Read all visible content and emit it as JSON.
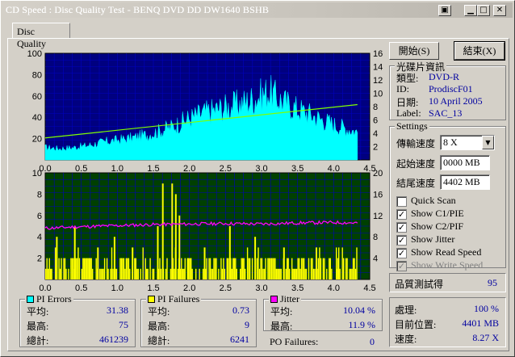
{
  "window": {
    "title": "CD Speed : Disc Quality Test - BENQ    DVD DD DW1640    BSHB",
    "min_glyph": "▁",
    "max_glyph": "□",
    "close_glyph": "✕",
    "help_glyph": "▣"
  },
  "tab": {
    "label": "Disc Quality"
  },
  "buttons": {
    "start": "開始(S)",
    "exit": "結束(X)"
  },
  "disc_info": {
    "title": "光碟片資訊",
    "type_label": "類型:",
    "type_value": "DVD-R",
    "id_label": "ID:",
    "id_value": "ProdiscF01",
    "date_label": "日期:",
    "date_value": "10 April 2005",
    "label_label": "Label:",
    "label_value": "SAC_13"
  },
  "settings": {
    "title": "Settings",
    "speed_label": "傳輸速度",
    "speed_value": "8 X",
    "start_label": "起始速度",
    "start_value": "0000 MB",
    "end_label": "結尾速度",
    "end_value": "4402 MB",
    "options": [
      {
        "label": "Quick Scan",
        "checked": ""
      },
      {
        "label": "Show C1/PIE",
        "checked": "✓"
      },
      {
        "label": "Show C2/PIF",
        "checked": "✓"
      },
      {
        "label": "Show Jitter",
        "checked": "✓"
      },
      {
        "label": "Show Read Speed",
        "checked": "✓"
      },
      {
        "label": "Show Write Speed",
        "checked": "✓"
      }
    ]
  },
  "quality": {
    "label": "品質測試得",
    "value": "95"
  },
  "progress": {
    "process_label": "處理:",
    "process_value": "100 %",
    "position_label": "目前位置:",
    "position_value": "4401 MB",
    "speed_label": "速度:",
    "speed_value": "8.27 X"
  },
  "pi_errors": {
    "title": "PI Errors",
    "avg_label": "平均:",
    "avg": "31.38",
    "max_label": "最高:",
    "max": "75",
    "total_label": "總計:",
    "total": "461239",
    "color": "#00ffff"
  },
  "pi_failures": {
    "title": "PI Failures",
    "avg_label": "平均:",
    "avg": "0.73",
    "max_label": "最高:",
    "max": "9",
    "total_label": "總計:",
    "total": "6241",
    "color": "#ffff00"
  },
  "jitter": {
    "title": "Jitter",
    "avg_label": "平均:",
    "avg": "10.04 %",
    "max_label": "最高:",
    "max": "11.9 %",
    "color": "#ff00ff"
  },
  "po_failures": {
    "label": "PO Failures:",
    "value": "0"
  },
  "chart_data": [
    {
      "type": "area",
      "title": "",
      "x_ticks": [
        "0.0",
        "0.5",
        "1.0",
        "1.5",
        "2.0",
        "2.5",
        "3.0",
        "3.5",
        "4.0",
        "4.5"
      ],
      "y_left_ticks": [
        "100",
        "80",
        "60",
        "40",
        "20"
      ],
      "y_right_ticks": [
        "16",
        "14",
        "12",
        "10",
        "8",
        "6",
        "4",
        "2"
      ],
      "xlim": [
        0,
        4.5
      ],
      "ylim_left": [
        0,
        100
      ],
      "ylim_right": [
        0,
        16
      ],
      "series": [
        {
          "name": "PI Errors",
          "color": "#00ffff",
          "x": [
            0.0,
            0.2,
            0.4,
            0.6,
            0.8,
            1.0,
            1.2,
            1.4,
            1.6,
            1.8,
            2.0,
            2.2,
            2.4,
            2.6,
            2.8,
            3.0,
            3.1,
            3.2,
            3.4,
            3.6,
            3.8,
            4.0,
            4.2,
            4.33
          ],
          "values": [
            12,
            11,
            12,
            14,
            17,
            19,
            21,
            24,
            28,
            33,
            40,
            45,
            49,
            52,
            56,
            62,
            66,
            60,
            52,
            46,
            40,
            34,
            30,
            27
          ]
        },
        {
          "name": "Read Speed",
          "color": "#80ff00",
          "x": [
            0.0,
            4.33
          ],
          "values": [
            3.3,
            8.3
          ]
        }
      ]
    },
    {
      "type": "bar",
      "title": "",
      "x_ticks": [
        "0.0",
        "0.5",
        "1.0",
        "1.5",
        "2.0",
        "2.5",
        "3.0",
        "3.5",
        "4.0",
        "4.5"
      ],
      "y_left_ticks": [
        "10",
        "8",
        "6",
        "4",
        "2"
      ],
      "y_right_ticks": [
        "20",
        "16",
        "12",
        "8",
        "4"
      ],
      "xlim": [
        0,
        4.5
      ],
      "ylim_left": [
        0,
        10
      ],
      "ylim_right": [
        0,
        20
      ],
      "series": [
        {
          "name": "PI Failures",
          "color": "#ffff00",
          "x": [
            0.15,
            0.4,
            0.72,
            0.95,
            1.2,
            1.55,
            1.62,
            1.75,
            1.8,
            1.85,
            2.2,
            2.55,
            2.9,
            3.3,
            3.75,
            4.05
          ],
          "values": [
            4,
            5,
            3,
            4,
            3,
            5,
            9,
            9,
            8,
            6,
            3,
            5,
            4,
            3,
            3,
            2
          ]
        },
        {
          "name": "Jitter",
          "color": "#ff00ff",
          "x": [
            0.0,
            0.5,
            1.0,
            1.5,
            2.0,
            2.5,
            3.0,
            3.5,
            4.0,
            4.33
          ],
          "values": [
            9.6,
            9.9,
            10.1,
            10.3,
            10.4,
            10.5,
            10.4,
            10.6,
            10.7,
            10.6
          ]
        }
      ]
    }
  ]
}
